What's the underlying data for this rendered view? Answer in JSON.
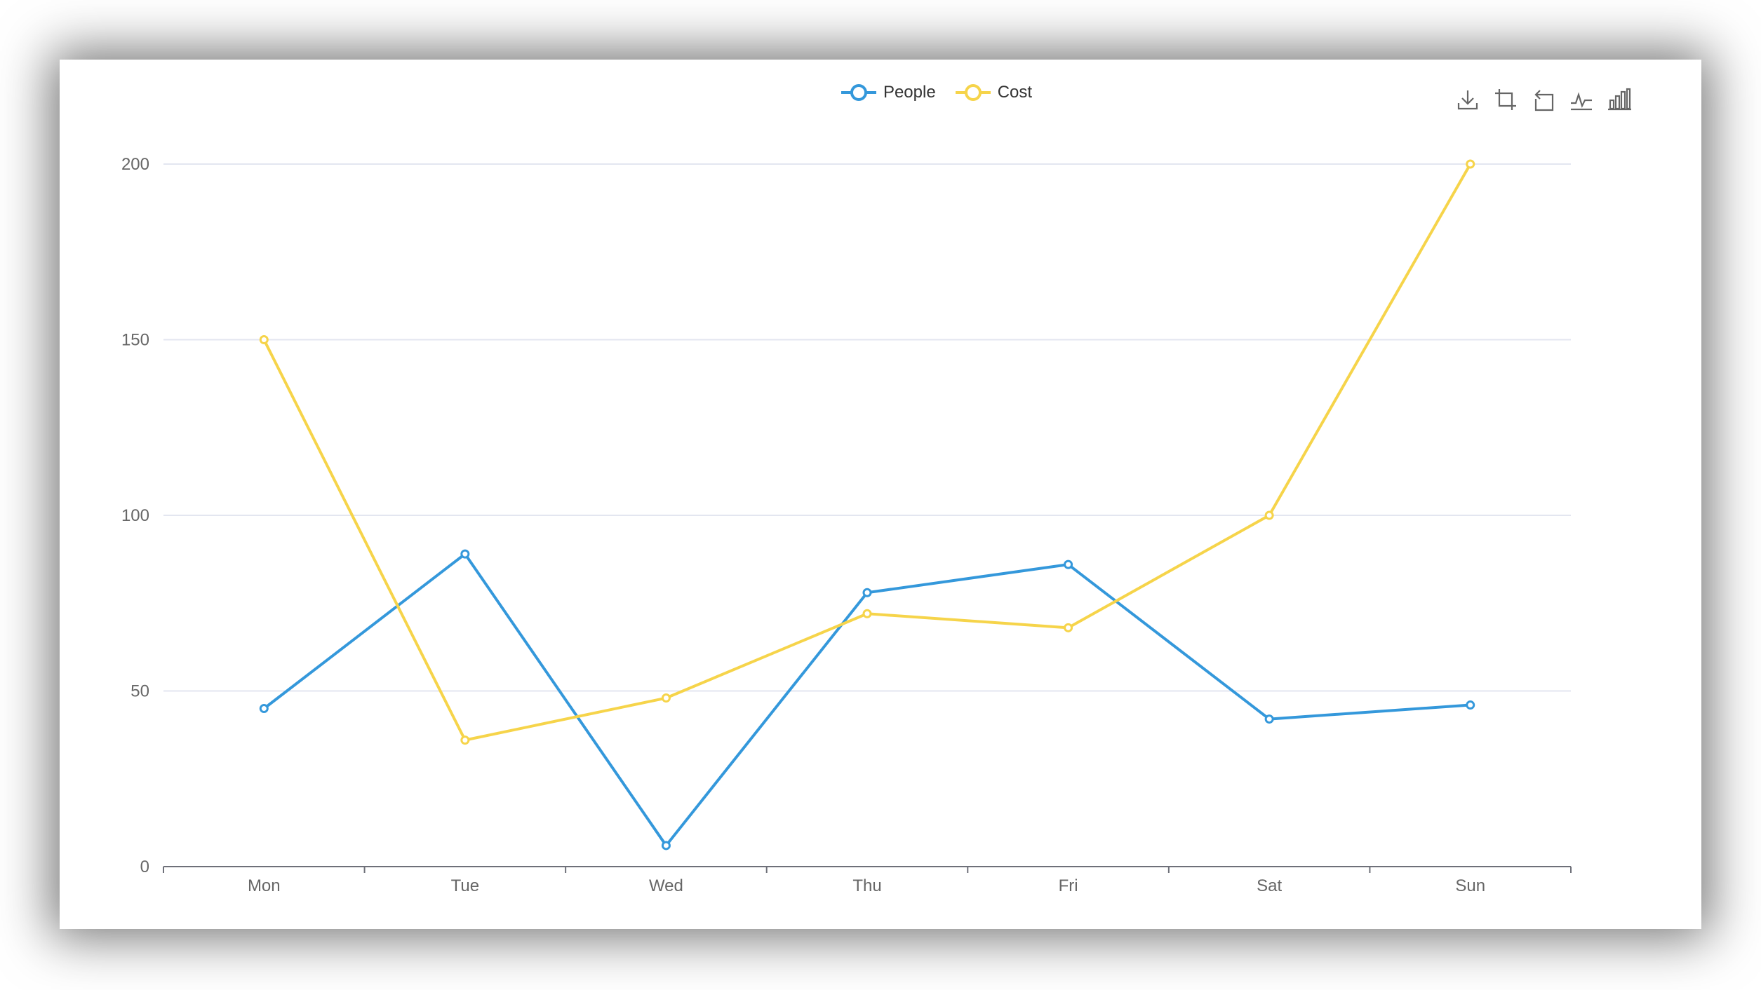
{
  "legend": {
    "items": [
      {
        "label": "People",
        "color": "#3498db"
      },
      {
        "label": "Cost",
        "color": "#f6d44a"
      }
    ]
  },
  "toolbox": {
    "icons": [
      "download-icon",
      "zoom-icon",
      "zoom-reset-icon",
      "line-chart-icon",
      "bar-chart-icon"
    ]
  },
  "colors": {
    "grid": "#e3e6f0",
    "axis": "#6e7079",
    "label": "#666666"
  },
  "chart_data": {
    "type": "line",
    "title": "",
    "xlabel": "",
    "ylabel": "",
    "categories": [
      "Mon",
      "Tue",
      "Wed",
      "Thu",
      "Fri",
      "Sat",
      "Sun"
    ],
    "ylim": [
      0,
      200
    ],
    "yticks": [
      0,
      50,
      100,
      150,
      200
    ],
    "grid": true,
    "legend_position": "top-center",
    "series": [
      {
        "name": "People",
        "color": "#3498db",
        "values": [
          45,
          89,
          6,
          78,
          86,
          42,
          46
        ]
      },
      {
        "name": "Cost",
        "color": "#f6d44a",
        "values": [
          150,
          36,
          48,
          72,
          68,
          100,
          200
        ]
      }
    ]
  }
}
